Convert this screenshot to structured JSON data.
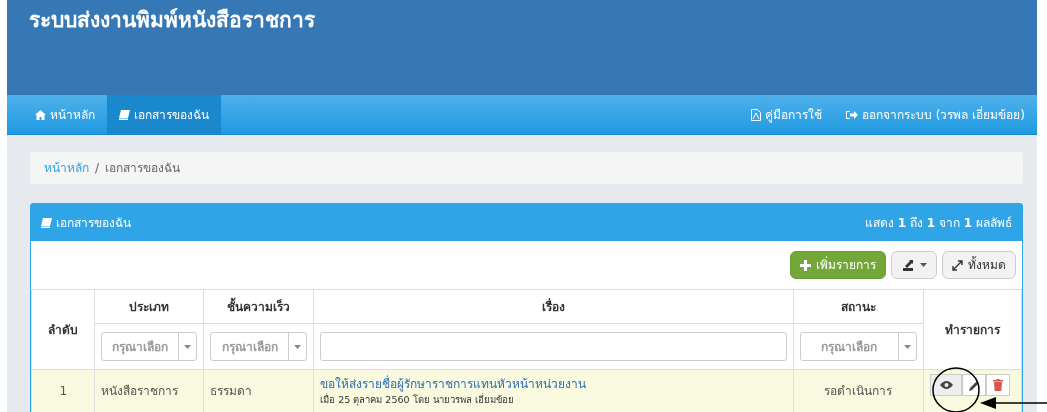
{
  "app_title": "ระบบส่งงานพิมพ์หนังสือราชการ",
  "nav_left": [
    {
      "label": "หน้าหลัก",
      "selected": false
    },
    {
      "label": "เอกสารของฉัน",
      "selected": true
    }
  ],
  "nav_right": [
    {
      "label": "คู่มือการใช้"
    },
    {
      "label": "ออกจากระบบ (วรพล เอี่ยมข้อย)"
    }
  ],
  "breadcrumb": [
    "หน้าหลัก",
    "เอกสารของฉัน"
  ],
  "breadcrumb_separator": "/",
  "panel": {
    "title": "เอกสารของฉัน",
    "summary": "แสดง **1** ถึง **1** จาก **1** ผลลัพธ์"
  },
  "toolbar": {
    "add_button": "เพิ่มรายการ",
    "expand_button": "ทั้งหมด"
  },
  "table": {
    "columns": [
      "ลำดับ",
      "ประเภท",
      "ชั้นความเร็ว",
      "เรื่อง",
      "สถานะ",
      "ทำรายการ"
    ],
    "filters": [
      {
        "kind": "none"
      },
      {
        "kind": "select",
        "placeholder": "กรุณาเลือก"
      },
      {
        "kind": "select",
        "placeholder": "กรุณาเลือก"
      },
      {
        "kind": "text"
      },
      {
        "kind": "select",
        "placeholder": "กรุณาเลือก"
      },
      {
        "kind": "none"
      }
    ],
    "rows": [
      {
        "no": "1",
        "type": "หนังสือราชการ",
        "speed": "ธรรมดา",
        "subject": "ขอให้ส่งรายชื่อผู้รักษาราชการแทนหัวหน้าหน่วยงาน",
        "meta": "เมื่อ 25 ตุลาคม 2560 โดย นายวรพล เอี่ยมข้อย",
        "status": "รอดำเนินการ"
      }
    ]
  }
}
